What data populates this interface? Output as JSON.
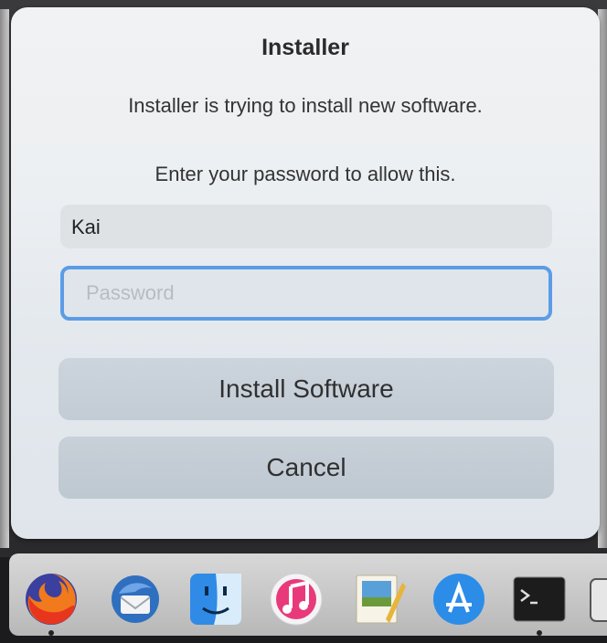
{
  "dialog": {
    "title": "Installer",
    "message": "Installer is trying to install new software.",
    "info": "Enter your password to allow this.",
    "username_value": "Kai",
    "password_placeholder": "Password",
    "install_label": "Install Software",
    "cancel_label": "Cancel"
  },
  "dock": {
    "items": [
      {
        "name": "firefox-icon",
        "running": true
      },
      {
        "name": "thunderbird-icon",
        "running": false
      },
      {
        "name": "finder-icon",
        "running": false
      },
      {
        "name": "itunes-icon",
        "running": false
      },
      {
        "name": "preview-icon",
        "running": false
      },
      {
        "name": "app-store-icon",
        "running": false
      },
      {
        "name": "terminal-icon",
        "running": true
      }
    ]
  },
  "colors": {
    "focus_ring": "#5c9ce6",
    "dialog_bg": "#eceff2"
  }
}
